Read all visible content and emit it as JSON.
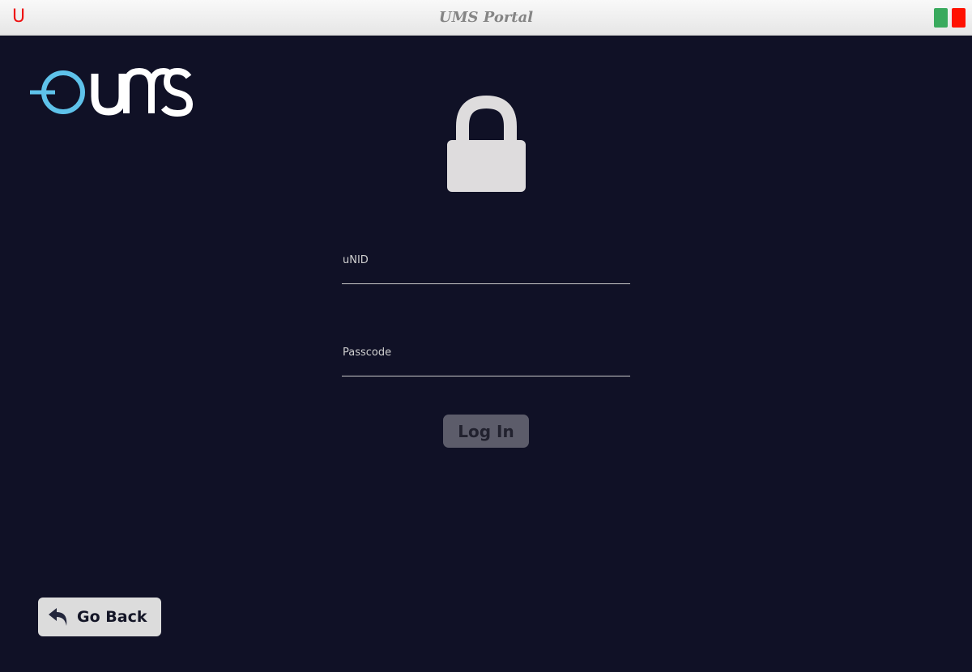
{
  "titlebar": {
    "app_glyph": "U",
    "title": "UMS Portal"
  },
  "logo": {
    "text": "UMS",
    "colors": {
      "ring": "#5ec2ea",
      "letters": "#ffffff"
    }
  },
  "lock": {
    "icon": "lock-icon",
    "color": "#dedcdd"
  },
  "form": {
    "unid_label": "uNID",
    "passcode_label": "Passcode",
    "login_label": "Log In"
  },
  "back": {
    "label": "Go Back",
    "icon": "reply-arrow-icon"
  },
  "colors": {
    "background": "#101126",
    "close": "#ff1100",
    "maximize": "#3aaa5e"
  }
}
